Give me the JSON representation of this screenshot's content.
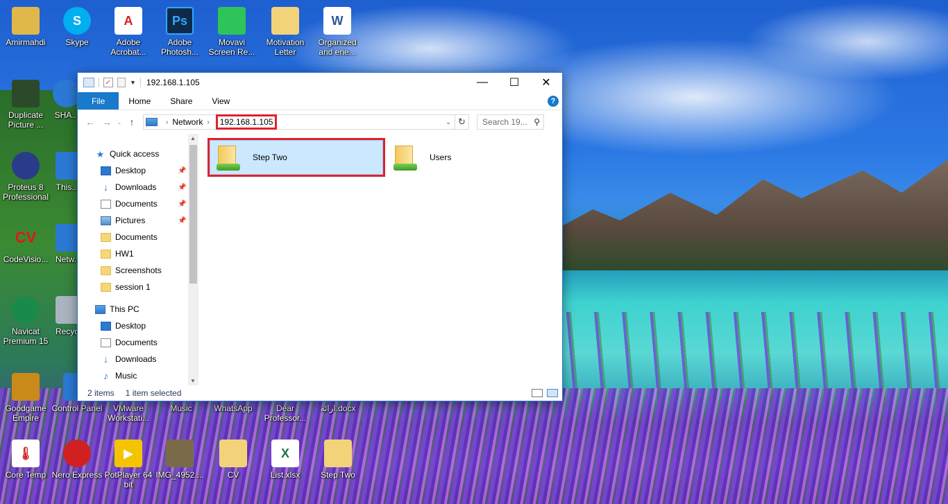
{
  "desktop_icons": [
    {
      "label": "Amirmahdi",
      "glyph": "",
      "color": "#e0b84a"
    },
    {
      "label": "Skype",
      "glyph": "S",
      "color": "#00aff0"
    },
    {
      "label": "Adobe Acrobat...",
      "glyph": "A",
      "color": "#d4201c"
    },
    {
      "label": "Adobe Photosh...",
      "glyph": "Ps",
      "color": "#0d2a4a"
    },
    {
      "label": "Movavi Screen Re...",
      "glyph": "",
      "color": "#2ec45a"
    },
    {
      "label": "Motivation Letter",
      "glyph": "",
      "color": "#f3d37a"
    },
    {
      "label": "Organized and ene...",
      "glyph": "W",
      "color": "#2b579a"
    },
    {
      "label": "Duplicate Picture ...",
      "glyph": "",
      "color": "#2b4a2a"
    },
    {
      "label": "SHA...",
      "glyph": "",
      "color": "#2b79d4"
    },
    {
      "label": "Proteus 8 Professional",
      "glyph": "",
      "color": "#2a3b8a"
    },
    {
      "label": "This...",
      "glyph": "",
      "color": "#2b79d4"
    },
    {
      "label": "CodeVisio...",
      "glyph": "CV",
      "color": "#c01818"
    },
    {
      "label": "Netw...",
      "glyph": "",
      "color": "#2b79d4"
    },
    {
      "label": "Navicat Premium 15",
      "glyph": "",
      "color": "#1a8a4a"
    },
    {
      "label": "Recyc...",
      "glyph": "",
      "color": "#aab4c0"
    },
    {
      "label": "Goodgame Empire",
      "glyph": "",
      "color": "#c98a1a"
    },
    {
      "label": "Control Panel",
      "glyph": "",
      "color": "#2b79d4"
    },
    {
      "label": "VMware Workstati...",
      "glyph": "",
      "color": "#555555"
    },
    {
      "label": "Music",
      "glyph": "",
      "color": "#5a5a5a"
    },
    {
      "label": "WhatsApp",
      "glyph": "",
      "color": "#25d366"
    },
    {
      "label": "Dear Professor...",
      "glyph": "",
      "color": "#2b579a"
    },
    {
      "label": "ارائه.docx",
      "glyph": "",
      "color": "#2b579a"
    },
    {
      "label": "Core Temp",
      "glyph": "",
      "color": "#d02020"
    },
    {
      "label": "Nero Express",
      "glyph": "",
      "color": "#d02020"
    },
    {
      "label": "PotPlayer 64 bit",
      "glyph": "▶",
      "color": "#f5c400"
    },
    {
      "label": "IMG_4952....",
      "glyph": "",
      "color": "#7a6a4a"
    },
    {
      "label": "CV",
      "glyph": "",
      "color": "#f3d37a"
    },
    {
      "label": "List.xlsx",
      "glyph": "X",
      "color": "#217346"
    },
    {
      "label": "Step Two",
      "glyph": "",
      "color": "#f3d37a"
    }
  ],
  "window": {
    "title": "192.168.1.105",
    "controls": {
      "minimize": "—",
      "maximize": "☐",
      "close": "✕"
    },
    "ribbon_tabs": [
      "File",
      "Home",
      "Share",
      "View"
    ],
    "help": "?",
    "address": {
      "crumbs": [
        "Network",
        "192.168.1.105"
      ],
      "refresh": "↻",
      "dropdown": "⌄"
    },
    "search_placeholder": "Search 19...",
    "nav": {
      "quick_access": "Quick access",
      "quick_items": [
        "Desktop",
        "Downloads",
        "Documents",
        "Pictures",
        "Documents",
        "HW1",
        "Screenshots",
        "session 1"
      ],
      "this_pc": "This PC",
      "pc_items": [
        "Desktop",
        "Documents",
        "Downloads",
        "Music"
      ]
    },
    "content_items": [
      {
        "name": "Step Two",
        "selected": true
      },
      {
        "name": "Users",
        "selected": false
      }
    ],
    "status": {
      "count": "2 items",
      "selection": "1 item selected"
    }
  },
  "colors": {
    "accent": "#1979ca",
    "highlight_box": "#e2202c",
    "selection": "#cce8ff"
  }
}
